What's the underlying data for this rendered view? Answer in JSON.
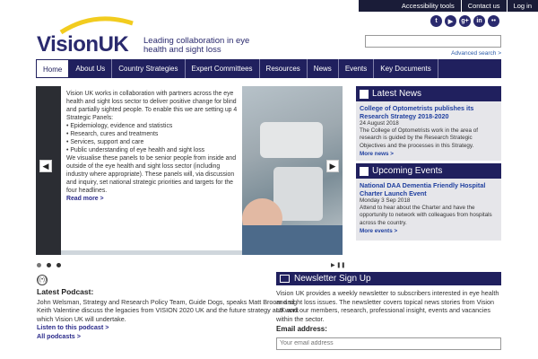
{
  "topbar": {
    "accessibility": "Accessibility tools",
    "contact": "Contact us",
    "login": "Log in"
  },
  "brand": {
    "name": "VisionUK",
    "tagline": "Leading collaboration in eye health and sight loss"
  },
  "social": [
    "twitter-icon",
    "youtube-icon",
    "googleplus-icon",
    "linkedin-icon",
    "flickr-icon"
  ],
  "search": {
    "placeholder": "",
    "advanced": "Advanced search >"
  },
  "nav": [
    "Home",
    "About Us",
    "Country Strategies",
    "Expert Committees",
    "Resources",
    "News",
    "Events",
    "Key Documents"
  ],
  "slider": {
    "para1": "Vision UK works in collaboration with partners across the eye health and sight loss sector to deliver positive change for blind and partially sighted people. To enable this we are setting up 4 Strategic Panels:",
    "bullets": [
      "• Epidemiology, evidence and statistics",
      "• Research, cures and treatments",
      "• Services, support and care",
      "• Public understanding of eye health and sight loss"
    ],
    "para2": "We visualise these panels to be senior people from inside and outside of the eye health and sight loss sector (including industry where appropriate). These panels will, via discussion and inquiry, set national strategic priorities and targets for the four headlines.",
    "more": "Read more >"
  },
  "news": {
    "heading": "Latest News",
    "title": "College of Optometrists publishes its Research Strategy 2018-2020",
    "date": "24 August 2018",
    "text": "The College of Optometrists work in the area of research is guided by the Research Strategic Objectives and the processes in this Strategy.",
    "more": "More news >"
  },
  "events": {
    "heading": "Upcoming Events",
    "title": "National DAA Dementia Friendly Hospital Charter Launch Event",
    "date": "Monday 3 Sep 2018",
    "text": "Attend to hear about the Charter and have the opportunity to network with colleagues from hospitals across the country.",
    "more": "More events >"
  },
  "podcast": {
    "heading": "Latest Podcast:",
    "text": "John Welsman, Strategy and Research Policy Team, Guide Dogs, speaks Matt Broom and Keith Valentine discuss the legacies from VISION 2020 UK and the future strategy and work which Vision UK will undertake.",
    "listen": "Listen to this podcast >",
    "all": "All podcasts >"
  },
  "newsletter": {
    "heading": "Newsletter Sign Up",
    "text": "Vision UK provides a weekly newsletter to subscribers interested in eye health and sight loss issues. The newsletter covers topical news stories from Vision UK and our members, research, professional insight, events and vacancies within the sector.",
    "email_label": "Email address:",
    "email_placeholder": "Your email address"
  },
  "slider_controls": {
    "pause": "▶ ❚❚"
  }
}
